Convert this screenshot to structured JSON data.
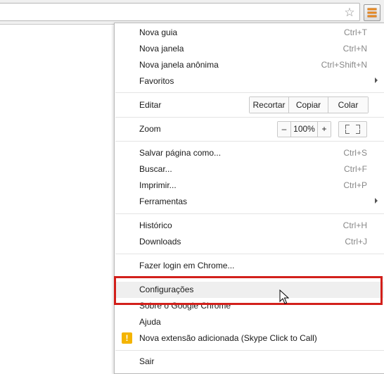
{
  "menu": {
    "items": [
      {
        "label": "Nova guia",
        "shortcut": "Ctrl+T"
      },
      {
        "label": "Nova janela",
        "shortcut": "Ctrl+N"
      },
      {
        "label": "Nova janela anônima",
        "shortcut": "Ctrl+Shift+N"
      },
      {
        "label": "Favoritos",
        "shortcut": ""
      },
      {
        "label": "Editar",
        "shortcut": ""
      },
      {
        "label": "Zoom",
        "shortcut": ""
      },
      {
        "label": "Salvar página como...",
        "shortcut": "Ctrl+S"
      },
      {
        "label": "Buscar...",
        "shortcut": "Ctrl+F"
      },
      {
        "label": "Imprimir...",
        "shortcut": "Ctrl+P"
      },
      {
        "label": "Ferramentas",
        "shortcut": ""
      },
      {
        "label": "Histórico",
        "shortcut": "Ctrl+H"
      },
      {
        "label": "Downloads",
        "shortcut": "Ctrl+J"
      },
      {
        "label": "Fazer login em Chrome...",
        "shortcut": ""
      },
      {
        "label": "Configurações",
        "shortcut": ""
      },
      {
        "label": "Sobre o Google Chrome",
        "shortcut": ""
      },
      {
        "label": "Ajuda",
        "shortcut": ""
      },
      {
        "label": "Nova extensão adicionada (Skype Click to Call)",
        "shortcut": ""
      },
      {
        "label": "Sair",
        "shortcut": ""
      }
    ],
    "edit_buttons": {
      "cut": "Recortar",
      "copy": "Copiar",
      "paste": "Colar"
    },
    "zoom": {
      "minus": "–",
      "level": "100%",
      "plus": "+"
    },
    "warning_glyph": "!"
  },
  "icons": {
    "star": "star-icon",
    "menu": "hamburger-menu-icon",
    "submenu": "chevron-right-icon",
    "warning": "warning-icon",
    "fullscreen": "fullscreen-icon"
  },
  "colors": {
    "highlight": "#d2201b",
    "menu_icon": "#e8891f",
    "warning": "#f4b400"
  }
}
